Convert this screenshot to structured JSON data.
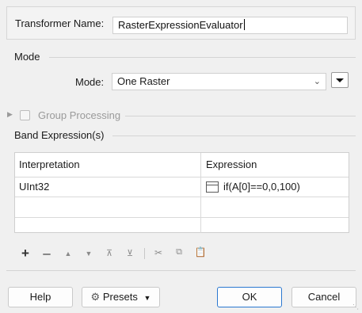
{
  "transformer": {
    "label": "Transformer Name:",
    "value": "RasterExpressionEvaluator"
  },
  "mode": {
    "group_title": "Mode",
    "label": "Mode:",
    "value": "One Raster"
  },
  "group_processing": {
    "label": "Group Processing",
    "checked": false,
    "expanded": false
  },
  "band_expressions": {
    "group_title": "Band Expression(s)",
    "columns": [
      "Interpretation",
      "Expression"
    ],
    "rows": [
      {
        "interpretation": "UInt32",
        "expression": "if(A[0]==0,0,100)"
      },
      {
        "interpretation": "",
        "expression": ""
      }
    ]
  },
  "toolbar": {
    "icons": [
      "plus-icon",
      "minus-icon",
      "move-up-icon",
      "move-down-icon",
      "move-top-icon",
      "move-bottom-icon",
      "cut-icon",
      "copy-icon",
      "paste-icon"
    ]
  },
  "footer": {
    "help_label": "Help",
    "presets_label": "Presets",
    "ok_label": "OK",
    "cancel_label": "Cancel"
  },
  "colors": {
    "primary_border": "#2b78d0",
    "background": "#f0f0f0"
  }
}
